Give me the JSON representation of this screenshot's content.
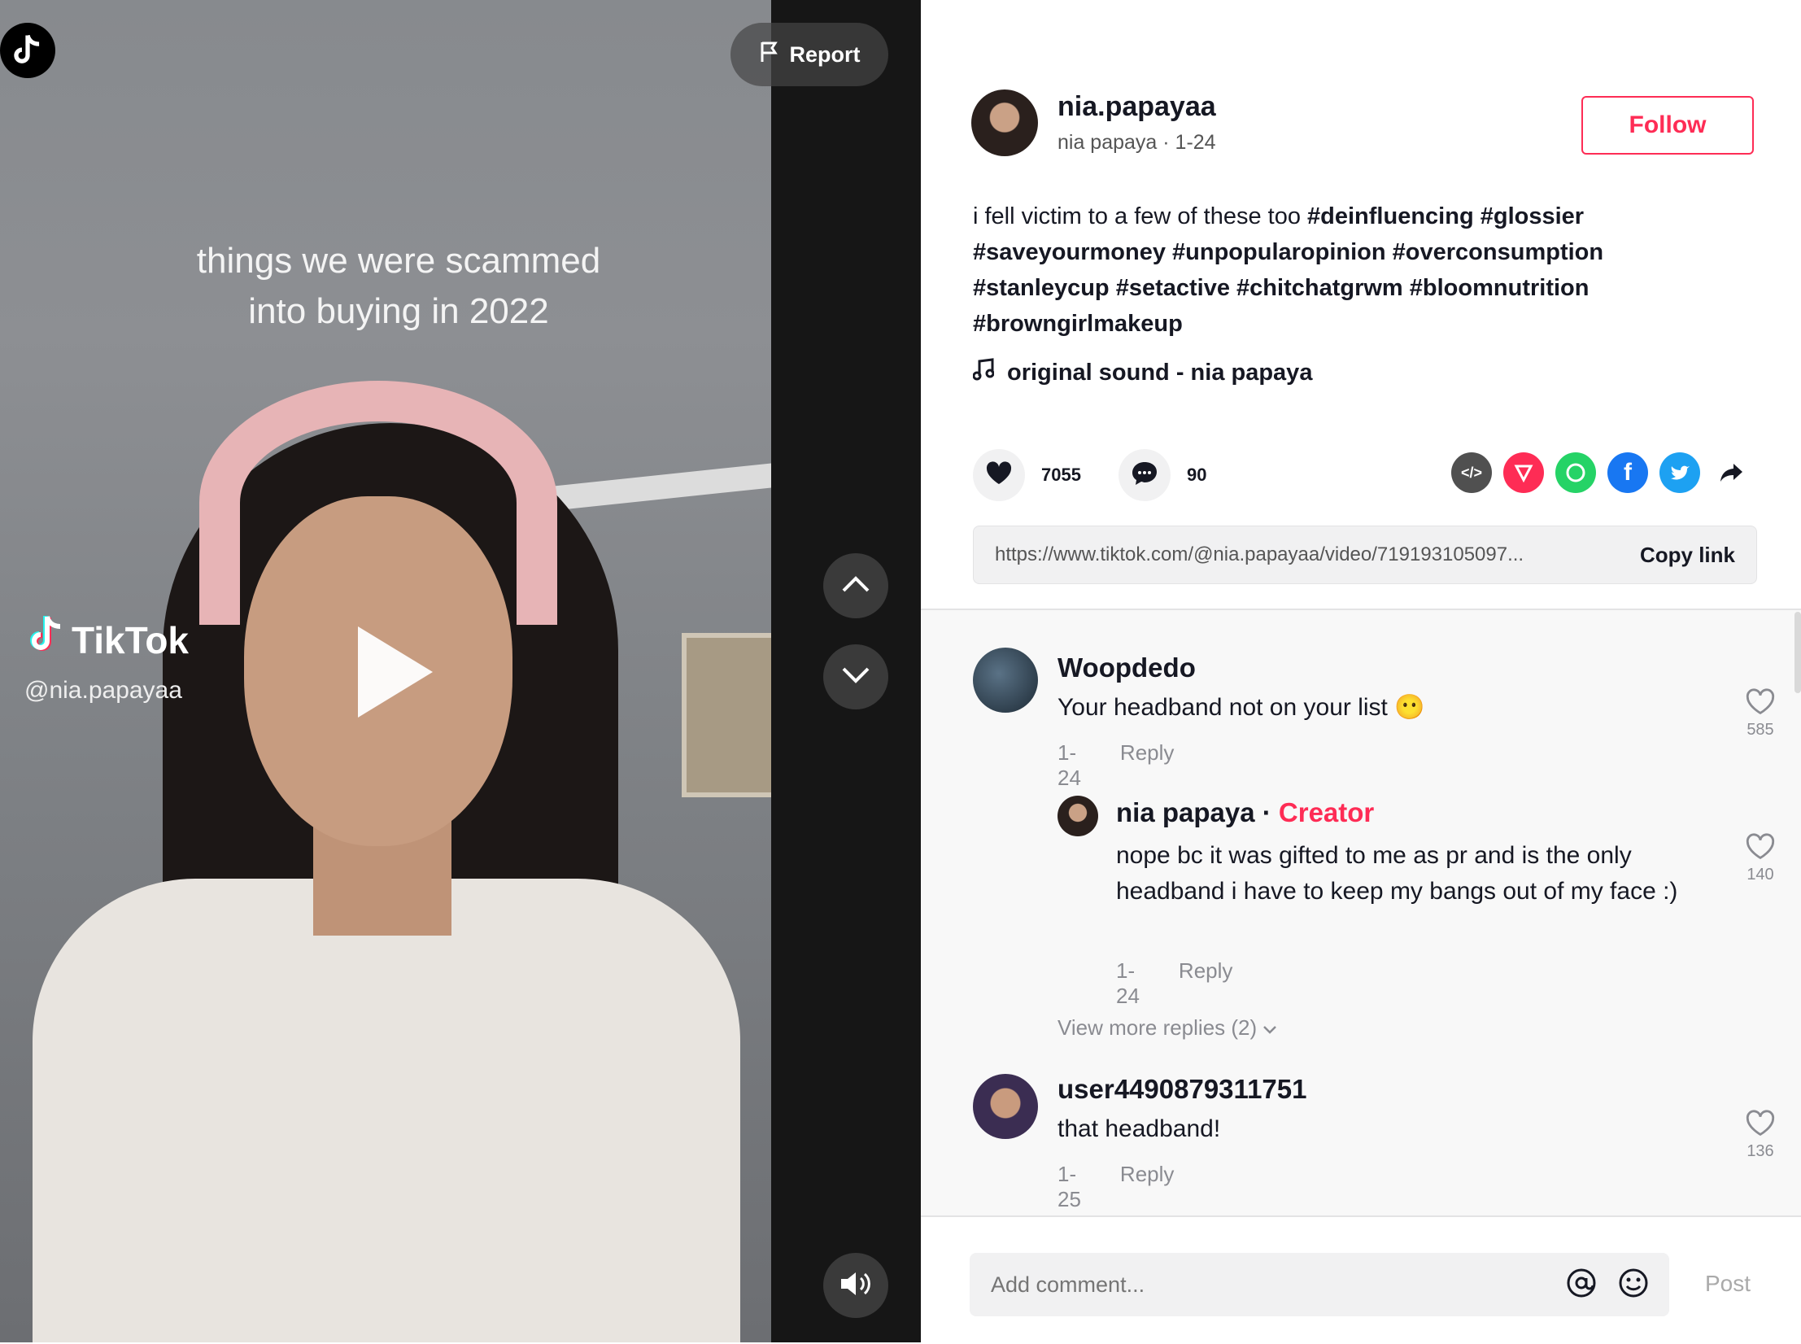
{
  "video": {
    "caption_line1": "things we were scammed",
    "caption_line2": "into buying in 2022",
    "watermark_brand": "TikTok",
    "watermark_handle": "@nia.papayaa",
    "report_label": "Report"
  },
  "author": {
    "username": "nia.papayaa",
    "display_name": "nia papaya",
    "date": "1-24",
    "follow_label": "Follow"
  },
  "description": {
    "text": "i fell victim to a few of these too",
    "hashtags": [
      "#deinfluencing",
      "#glossier",
      "#saveyourmoney",
      "#unpopularopinion",
      "#overconsumption",
      "#stanleycup",
      "#setactive",
      "#chitchatgrwm",
      "#bloomnutrition",
      "#browngirlmakeup"
    ]
  },
  "music": {
    "label": "original sound - nia papaya"
  },
  "stats": {
    "likes": "7055",
    "comments": "90"
  },
  "share": {
    "icons": [
      "embed-icon",
      "send-icon",
      "whatsapp-icon",
      "facebook-icon",
      "twitter-icon",
      "share-arrow-icon"
    ],
    "colors": {
      "embed": "#505050",
      "send": "#fe2c55",
      "whatsapp": "#25d366",
      "facebook": "#1877f2",
      "twitter": "#1da1f2"
    }
  },
  "link": {
    "url": "https://www.tiktok.com/@nia.papayaa/video/719193105097...",
    "copy_label": "Copy link"
  },
  "comments": [
    {
      "user": "Woopdedo",
      "text": "Your headband not on your list 😶",
      "date": "1-24",
      "reply": "Reply",
      "likes": "585"
    },
    {
      "user": "nia papaya",
      "badge": "Creator",
      "text": "nope bc it was gifted to me as pr and is the only headband i have to keep my bangs out of my face :)",
      "date": "1-24",
      "reply": "Reply",
      "likes": "140"
    },
    {
      "user": "user4490879311751",
      "text": "that headband!",
      "date": "1-25",
      "reply": "Reply",
      "likes": "136"
    }
  ],
  "view_more": "View more replies (2)",
  "composer": {
    "placeholder": "Add comment...",
    "post_label": "Post"
  },
  "colors": {
    "accent": "#fe2c55",
    "text": "#161823",
    "muted": "#8a8b91"
  }
}
